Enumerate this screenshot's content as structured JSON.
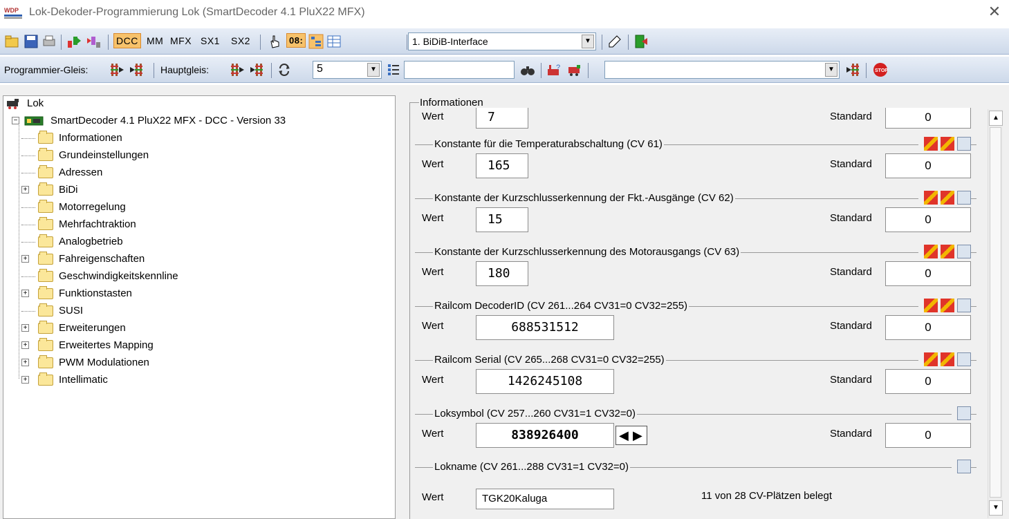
{
  "window": {
    "title": "Lok-Dekoder-Programmierung Lok (SmartDecoder 4.1 PluX22 MFX)",
    "app_icon": "wdp-icon",
    "close_glyph": "✕"
  },
  "toolbar1": {
    "protocols": [
      "DCC",
      "MM",
      "MFX",
      "SX1",
      "SX2"
    ],
    "active_protocol": "DCC",
    "address_badge": "08:",
    "interface": "1. BiDiB-Interface"
  },
  "toolbar2": {
    "prog_label": "Programmier-Gleis:",
    "main_label": "Hauptgleis:",
    "address_value": "5",
    "search_value": "",
    "filter_value": ""
  },
  "tree": {
    "root": "Lok",
    "decoder": "SmartDecoder 4.1 PluX22 MFX - DCC - Version 33",
    "items": [
      {
        "label": "Informationen",
        "expandable": false
      },
      {
        "label": "Grundeinstellungen",
        "expandable": false
      },
      {
        "label": "Adressen",
        "expandable": false
      },
      {
        "label": "BiDi",
        "expandable": true
      },
      {
        "label": "Motorregelung",
        "expandable": false
      },
      {
        "label": "Mehrfachtraktion",
        "expandable": false
      },
      {
        "label": "Analogbetrieb",
        "expandable": false
      },
      {
        "label": "Fahreigenschaften",
        "expandable": true
      },
      {
        "label": "Geschwindigkeitskennline",
        "expandable": false
      },
      {
        "label": "Funktionstasten",
        "expandable": true
      },
      {
        "label": "SUSI",
        "expandable": false
      },
      {
        "label": "Erweiterungen",
        "expandable": true
      },
      {
        "label": "Erweitertes Mapping",
        "expandable": true
      },
      {
        "label": "PWM Modulationen",
        "expandable": true
      },
      {
        "label": "Intellimatic",
        "expandable": true
      }
    ]
  },
  "panel": {
    "legend": "Informationen",
    "wert_label": "Wert",
    "standard_label": "Standard",
    "top_row": {
      "wert": "7",
      "standard": "0"
    },
    "groups": [
      {
        "title": "Konstante für die Temperaturabschaltung (CV 61)",
        "wert": "165",
        "standard": "0",
        "wide": false,
        "full_icons": true
      },
      {
        "title": "Konstante der Kurzschlusserkennung der Fkt.-Ausgänge (CV 62)",
        "wert": "15",
        "standard": "0",
        "wide": false,
        "full_icons": true
      },
      {
        "title": "Konstante der Kurzschlusserkennung des Motorausgangs (CV 63)",
        "wert": "180",
        "standard": "0",
        "wide": false,
        "full_icons": true
      },
      {
        "title": "Railcom DecoderID (CV 261...264 CV31=0 CV32=255)",
        "wert": "688531512",
        "standard": "0",
        "wide": true,
        "full_icons": true
      },
      {
        "title": "Railcom Serial (CV 265...268 CV31=0 CV32=255)",
        "wert": "1426245108",
        "standard": "0",
        "wide": true,
        "full_icons": true
      },
      {
        "title": "Loksymbol (CV 257...260 CV31=1 CV32=0)",
        "wert": "838926400",
        "standard": "0",
        "wide": true,
        "full_icons": false
      }
    ],
    "lokname": {
      "title": "Lokname (CV 261...288 CV31=1 CV32=0)",
      "value": "TGK20Kaluga",
      "info": "11 von 28 CV-Plätzen belegt"
    }
  }
}
